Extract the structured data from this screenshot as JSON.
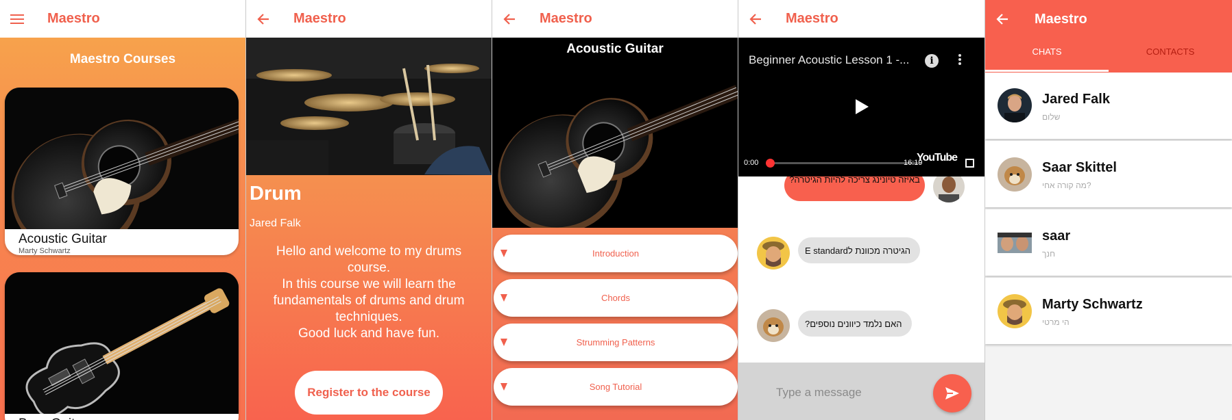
{
  "colors": {
    "accent": "#f0604d",
    "accent_strong": "#f8604e",
    "tab_inactive": "#b31d10"
  },
  "app": {
    "title": "Maestro"
  },
  "screen1": {
    "nav_icon": "menu-icon",
    "heading": "Maestro Courses",
    "courses": [
      {
        "name": "Acoustic Guitar",
        "author": "Marty Schwartz"
      },
      {
        "name": "Bass Guitar",
        "author": ""
      }
    ]
  },
  "screen2": {
    "nav_icon": "back-arrow-icon",
    "course_title": "Drum",
    "author": "Jared Falk",
    "description": "Hello and welcome to my drums course.\nIn this course we will learn the fundamentals of drums and drum techniques.\nGood luck and have fun.",
    "register_label": "Register to the course"
  },
  "screen3": {
    "nav_icon": "back-arrow-icon",
    "hero_title": "Acoustic Guitar",
    "sections": [
      "Introduction",
      "Chords",
      "Strumming Patterns",
      "Song Tutorial"
    ]
  },
  "screen4": {
    "nav_icon": "back-arrow-icon",
    "video": {
      "title": "Beginner Acoustic Lesson 1 -...",
      "time_current": "0:00",
      "time_total": "16:19",
      "brand": "YouTube"
    },
    "messages": [
      {
        "direction": "out",
        "text": "באיזה טיונינג צריכה להיות הגיטרה?"
      },
      {
        "direction": "in",
        "text": "הגיטרה מכוונת לE standard"
      },
      {
        "direction": "in",
        "text": "האם נלמד כיוונים נוספים?"
      }
    ],
    "input_placeholder": "Type a message"
  },
  "screen5": {
    "nav_icon": "back-arrow-icon",
    "tabs": [
      "CHATS",
      "CONTACTS"
    ],
    "active_tab": "CHATS",
    "contacts": [
      {
        "name": "Jared Falk",
        "last_message": "שלום"
      },
      {
        "name": "Saar Skittel",
        "last_message": "מה קורה אחי?"
      },
      {
        "name": "saar",
        "last_message": "חנך"
      },
      {
        "name": "Marty Schwartz",
        "last_message": "הי מרטי"
      }
    ]
  }
}
